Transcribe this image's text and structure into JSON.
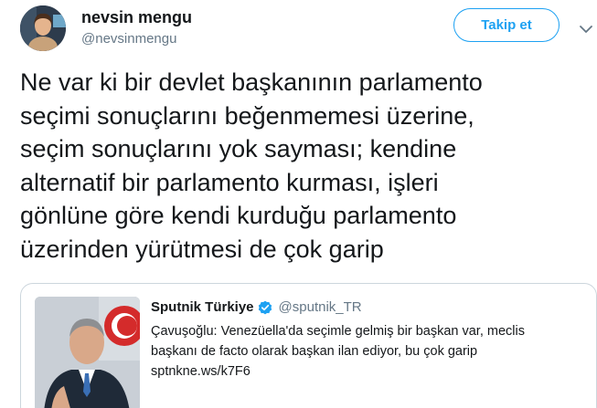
{
  "author": {
    "name": "nevsin mengu",
    "handle": "@nevsinmengu"
  },
  "follow_button": {
    "label": "Takip et"
  },
  "tweet": {
    "lines": [
      "Ne var ki bir devlet başkanının parlamento",
      "seçimi sonuçlarını beğenmemesi üzerine,",
      "seçim sonuçlarını yok sayması; kendine",
      "alternatif bir parlamento kurması, işleri",
      "gönlüne göre kendi kurduğu parlamento",
      "üzerinden yürütmesi de çok garip"
    ]
  },
  "quoted_tweet": {
    "name": "Sputnik Türkiye",
    "handle": "@sputnik_TR",
    "lines": [
      "Çavuşoğlu: Venezüella'da seçimle gelmiş bir başkan var, meclis",
      "başkanı de facto olarak başkan ilan ediyor, bu çok garip",
      "sptnkne.ws/k7F6"
    ]
  },
  "icons": {
    "menu": "chevron-down-icon",
    "verified": "verified-badge-icon"
  },
  "colors": {
    "accent": "#1da1f2",
    "text": "#14171a",
    "muted": "#657786",
    "border": "#ccd6dd"
  }
}
